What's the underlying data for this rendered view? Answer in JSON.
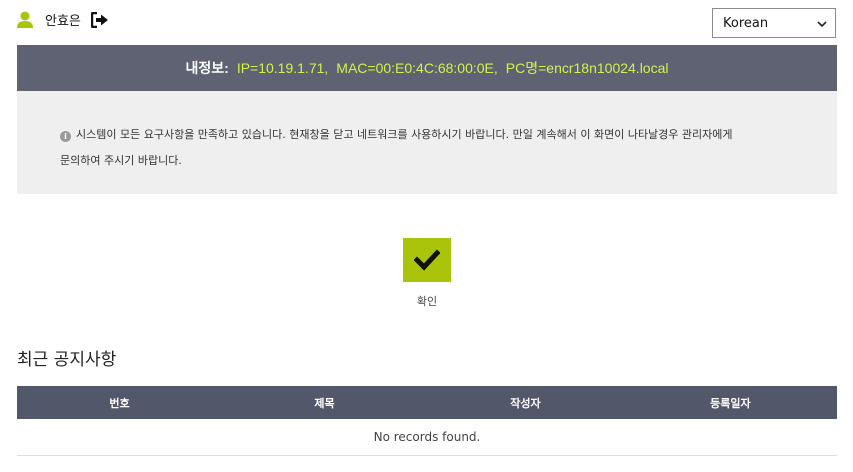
{
  "header": {
    "user_name": "안효은",
    "user_icon": "user-icon",
    "logout_icon": "sign-out-icon",
    "language": {
      "selected": "Korean",
      "options": [
        "Korean"
      ]
    }
  },
  "info_bar": {
    "label": "내정보:",
    "ip": "IP=10.19.1.71,",
    "mac": "MAC=00:E0:4C:68:00:0E,",
    "pc": "PC명=encr18n10024.local",
    "background_color": "#5e6272",
    "value_color": "#d8f04a"
  },
  "notice": {
    "icon": "info-circle-icon",
    "line1": "시스템이 모든 요구사항을 만족하고 있습니다. 현재창을 닫고 네트워크를 사용하시기 바랍니다. 만일 계속해서 이 화면이 나타날경우 관리자에게",
    "line2": "문의하여 주시기 바랍니다."
  },
  "confirm": {
    "icon": "check-icon",
    "label": "확인",
    "color": "#a9c40a"
  },
  "recent_notices": {
    "title": "최근 공지사항",
    "columns": [
      "번호",
      "제목",
      "작성자",
      "등록일자"
    ],
    "empty_message": "No records found."
  }
}
